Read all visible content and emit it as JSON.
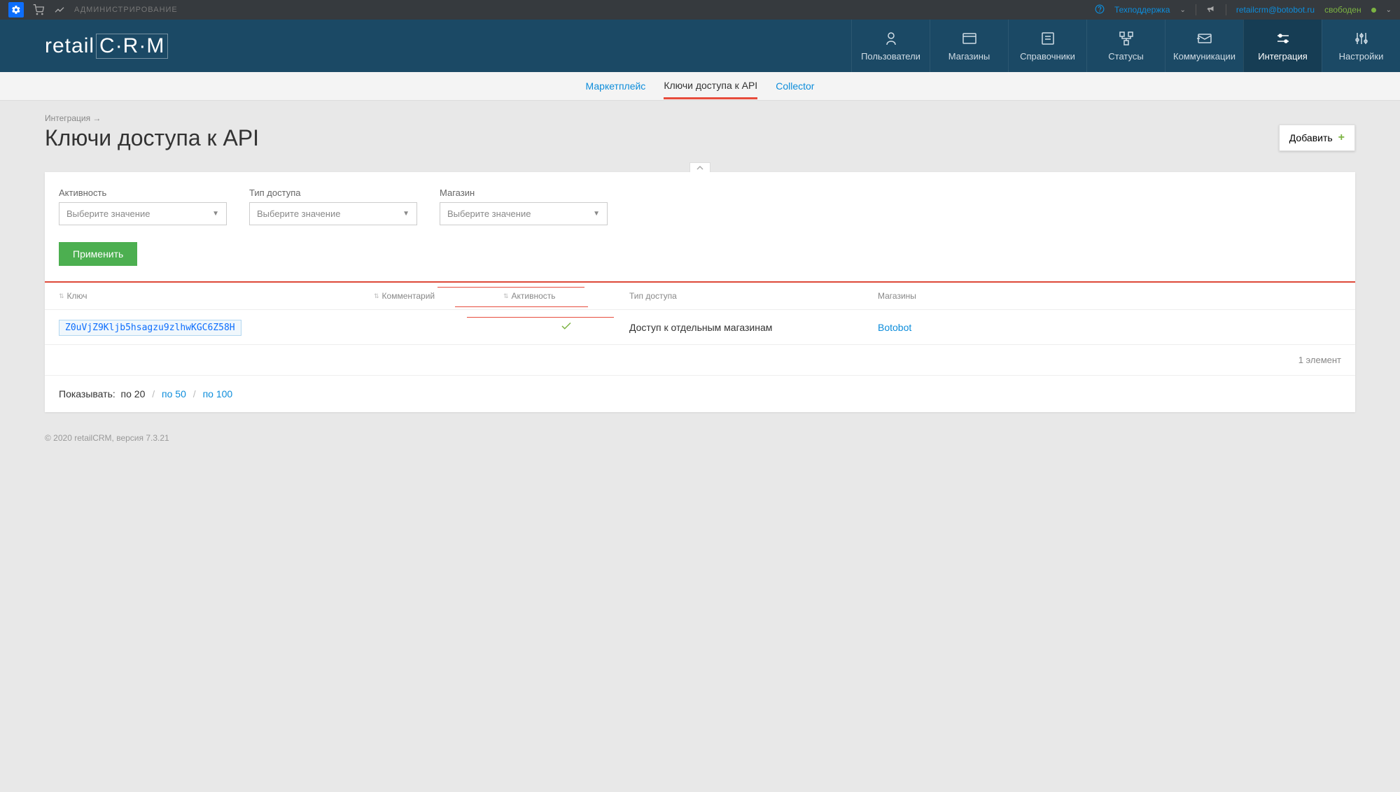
{
  "topbar": {
    "admin_label": "АДМИНИСТРИРОВАНИЕ",
    "support_label": "Техподдержка",
    "email": "retailcrm@botobot.ru",
    "status": "свободен"
  },
  "logo": "retailCRM",
  "nav": [
    {
      "label": "Пользователи"
    },
    {
      "label": "Магазины"
    },
    {
      "label": "Справочники"
    },
    {
      "label": "Статусы"
    },
    {
      "label": "Коммуникации"
    },
    {
      "label": "Интеграция"
    },
    {
      "label": "Настройки"
    }
  ],
  "subtabs": [
    {
      "label": "Маркетплейс"
    },
    {
      "label": "Ключи доступа к API"
    },
    {
      "label": "Collector"
    }
  ],
  "breadcrumb": "Интеграция →",
  "page_title": "Ключи доступа к API",
  "add_button": "Добавить",
  "filters": {
    "activity": {
      "label": "Активность",
      "placeholder": "Выберите значение"
    },
    "access_type": {
      "label": "Тип доступа",
      "placeholder": "Выберите значение"
    },
    "store": {
      "label": "Магазин",
      "placeholder": "Выберите значение"
    }
  },
  "apply_button": "Применить",
  "table": {
    "headers": {
      "key": "Ключ",
      "comment": "Комментарий",
      "active": "Активность",
      "access": "Тип доступа",
      "stores": "Магазины"
    },
    "rows": [
      {
        "key": "Z0uVjZ9Kljb5hsagzu9zlhwKGC6Z58H",
        "comment": "",
        "active": true,
        "access": "Доступ к отдельным магазинам",
        "store": "Botobot"
      }
    ],
    "footer_count": "1 элемент"
  },
  "pagination": {
    "label": "Показывать:",
    "opt20": "по 20",
    "opt50": "по 50",
    "opt100": "по 100"
  },
  "footer": "© 2020 retailCRM, версия 7.3.21"
}
